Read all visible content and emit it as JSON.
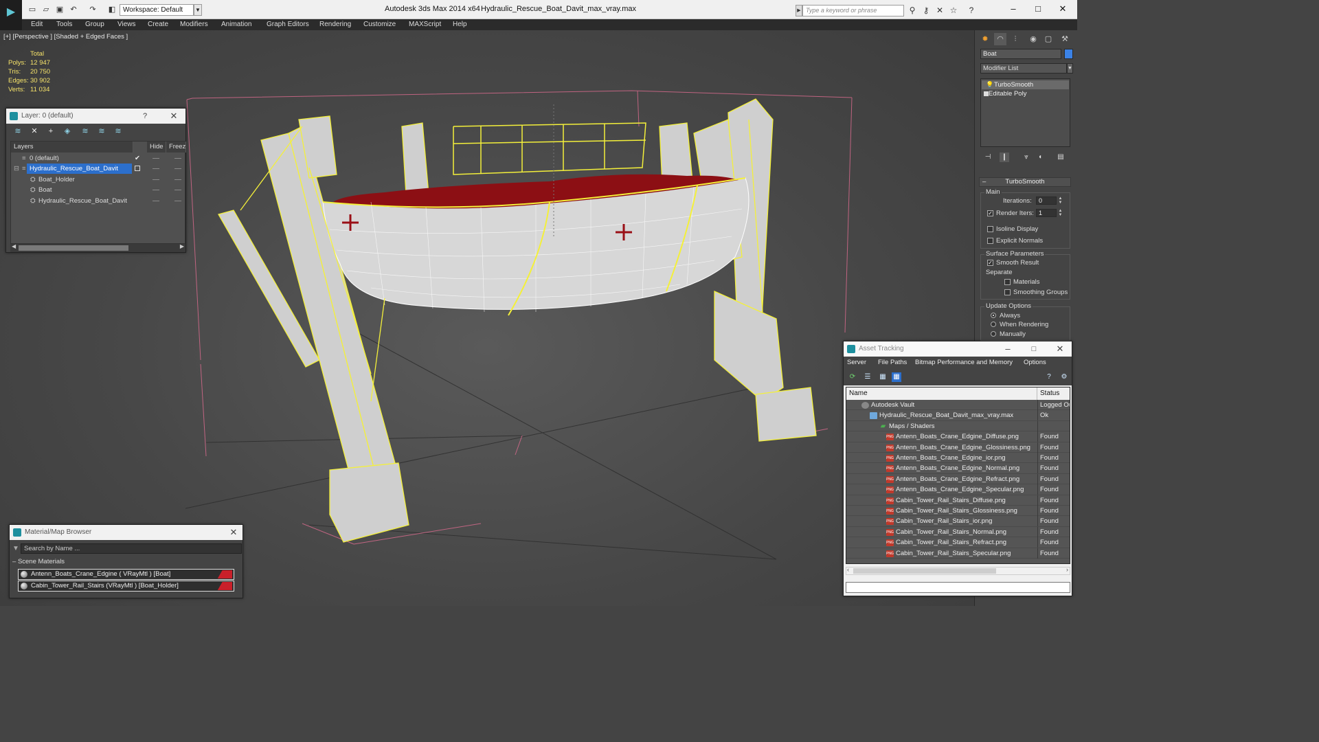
{
  "titlebar": {
    "workspace": "Workspace: Default",
    "app_title": "Autodesk 3ds Max  2014 x64",
    "file_title": "Hydraulic_Rescue_Boat_Davit_max_vray.max",
    "search_placeholder": "Type a keyword or phrase"
  },
  "menu": [
    "Edit",
    "Tools",
    "Group",
    "Views",
    "Create",
    "Modifiers",
    "Animation",
    "Graph Editors",
    "Rendering",
    "Customize",
    "MAXScript",
    "Help"
  ],
  "viewport": {
    "label": "[+] [Perspective ] [Shaded + Edged Faces ]",
    "stats_header": "Total",
    "stats": [
      {
        "label": "Polys:",
        "value": "12 947"
      },
      {
        "label": "Tris:",
        "value": "20 750"
      },
      {
        "label": "Edges:",
        "value": "30 902"
      },
      {
        "label": "Verts:",
        "value": "11 034"
      }
    ]
  },
  "layer_dialog": {
    "title": "Layer: 0 (default)",
    "help": "?",
    "columns": {
      "layers": "Layers",
      "hide": "Hide",
      "freeze": "Freeze"
    },
    "rows": [
      {
        "name": "0 (default)"
      },
      {
        "name": "Hydraulic_Rescue_Boat_Davit"
      },
      {
        "name": "Boat_Holder"
      },
      {
        "name": "Boat"
      },
      {
        "name": "Hydraulic_Rescue_Boat_Davit"
      }
    ]
  },
  "material_browser": {
    "title": "Material/Map Browser",
    "search_placeholder": "Search by Name ...",
    "group": "Scene Materials",
    "items": [
      {
        "label": "Antenn_Boats_Crane_Edgine  ( VRayMtl ) [Boat]"
      },
      {
        "label": "Cabin_Tower_Rail_Stairs  (VRayMtl ) [Boat_Holder]"
      }
    ]
  },
  "command_panel": {
    "object_name": "Boat",
    "object_color": "#3b82e6",
    "modifier_list": "Modifier List",
    "stack": [
      "TurboSmooth",
      "Editable Poly"
    ],
    "turbosmooth": {
      "title": "TurboSmooth",
      "main": "Main",
      "iterations_label": "Iterations:",
      "iterations": "0",
      "render_iters_label": "Render Iters:",
      "render_iters": "1",
      "isoline": "Isoline Display",
      "explicit_normals": "Explicit Normals",
      "surface_params": "Surface Parameters",
      "smooth_result": "Smooth Result",
      "separate": "Separate",
      "materials": "Materials",
      "smoothing_groups": "Smoothing Groups",
      "update_options": "Update Options",
      "always": "Always",
      "when_rendering": "When Rendering",
      "manually": "Manually"
    }
  },
  "asset_tracking": {
    "title": "Asset Tracking",
    "menu": [
      "Server",
      "File",
      "Paths",
      "Bitmap Performance and Memory",
      "Options"
    ],
    "columns": {
      "name": "Name",
      "status": "Status"
    },
    "rows": [
      {
        "name": "Autodesk Vault",
        "status": "Logged Ou",
        "level": 1,
        "icon": "vault"
      },
      {
        "name": "Hydraulic_Rescue_Boat_Davit_max_vray.max",
        "status": "Ok",
        "level": 2,
        "icon": "file"
      },
      {
        "name": "Maps / Shaders",
        "status": "",
        "level": 3,
        "icon": "maps"
      },
      {
        "name": "Antenn_Boats_Crane_Edgine_Diffuse.png",
        "status": "Found",
        "level": 4,
        "icon": "png"
      },
      {
        "name": "Antenn_Boats_Crane_Edgine_Glossiness.png",
        "status": "Found",
        "level": 4,
        "icon": "png"
      },
      {
        "name": "Antenn_Boats_Crane_Edgine_ior.png",
        "status": "Found",
        "level": 4,
        "icon": "png"
      },
      {
        "name": "Antenn_Boats_Crane_Edgine_Normal.png",
        "status": "Found",
        "level": 4,
        "icon": "png"
      },
      {
        "name": "Antenn_Boats_Crane_Edgine_Refract.png",
        "status": "Found",
        "level": 4,
        "icon": "png"
      },
      {
        "name": "Antenn_Boats_Crane_Edgine_Specular.png",
        "status": "Found",
        "level": 4,
        "icon": "png"
      },
      {
        "name": "Cabin_Tower_Rail_Stairs_Diffuse.png",
        "status": "Found",
        "level": 4,
        "icon": "png"
      },
      {
        "name": "Cabin_Tower_Rail_Stairs_Glossiness.png",
        "status": "Found",
        "level": 4,
        "icon": "png"
      },
      {
        "name": "Cabin_Tower_Rail_Stairs_ior.png",
        "status": "Found",
        "level": 4,
        "icon": "png"
      },
      {
        "name": "Cabin_Tower_Rail_Stairs_Normal.png",
        "status": "Found",
        "level": 4,
        "icon": "png"
      },
      {
        "name": "Cabin_Tower_Rail_Stairs_Refract.png",
        "status": "Found",
        "level": 4,
        "icon": "png"
      },
      {
        "name": "Cabin_Tower_Rail_Stairs_Specular.png",
        "status": "Found",
        "level": 4,
        "icon": "png"
      }
    ],
    "png_icon_text": "PNG"
  }
}
